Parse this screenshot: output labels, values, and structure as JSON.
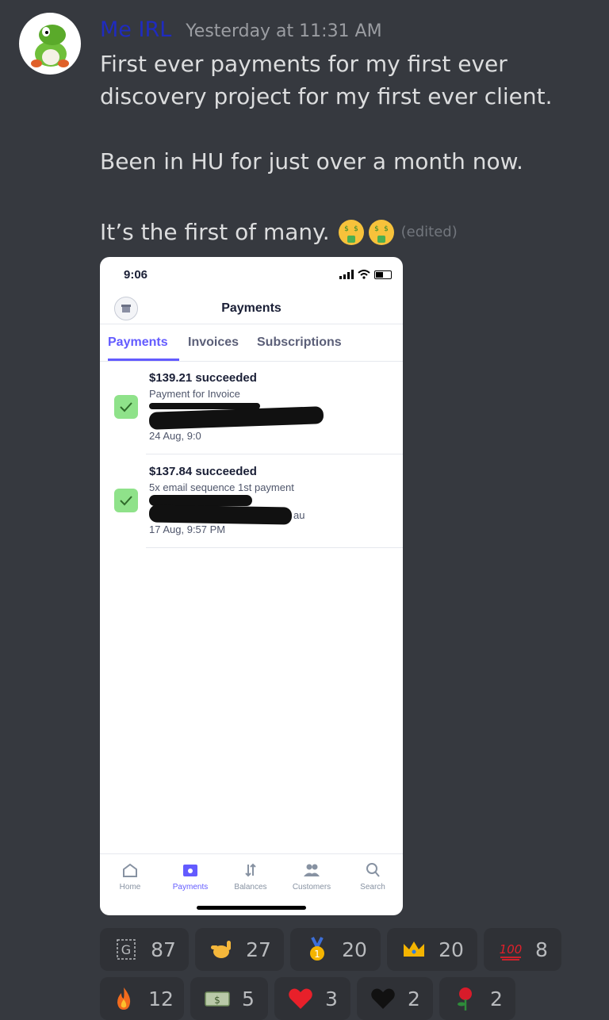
{
  "message": {
    "username": "Me IRL",
    "timestamp": "Yesterday at 11:31 AM",
    "line1": "First ever payments for my first ever discovery project for my first ever client.",
    "line2": "Been in HU for just over a month now.",
    "line3": "It’s the first of many.",
    "edited": "(edited)"
  },
  "phone": {
    "status_time": "9:06",
    "title": "Payments",
    "tabs": [
      "Payments",
      "Invoices",
      "Subscriptions"
    ],
    "payments": [
      {
        "amount": "$139.21 succeeded",
        "description": "Payment for Invoice",
        "date": "24 Aug, 9:0"
      },
      {
        "amount": "$137.84 succeeded",
        "description": "5x email sequence 1st payment",
        "date": "17 Aug, 9:57 PM",
        "fragment": "au"
      }
    ],
    "nav": [
      "Home",
      "Payments",
      "Balances",
      "Customers",
      "Search"
    ]
  },
  "reactions": [
    {
      "icon": "g-icon",
      "count": "87"
    },
    {
      "icon": "call-me-hand-icon",
      "count": "27"
    },
    {
      "icon": "first-place-medal-icon",
      "count": "20"
    },
    {
      "icon": "crown-icon",
      "count": "20"
    },
    {
      "icon": "hundred-points-icon",
      "count": "8"
    },
    {
      "icon": "fire-icon",
      "count": "12"
    },
    {
      "icon": "dollar-bill-icon",
      "count": "5"
    },
    {
      "icon": "red-heart-icon",
      "count": "3"
    },
    {
      "icon": "black-heart-icon",
      "count": "2"
    },
    {
      "icon": "rose-icon",
      "count": "2"
    }
  ],
  "colors": {
    "background": "#36393f",
    "username": "#1f2bbf",
    "accent": "#635bff",
    "check": "#8fe28a"
  }
}
